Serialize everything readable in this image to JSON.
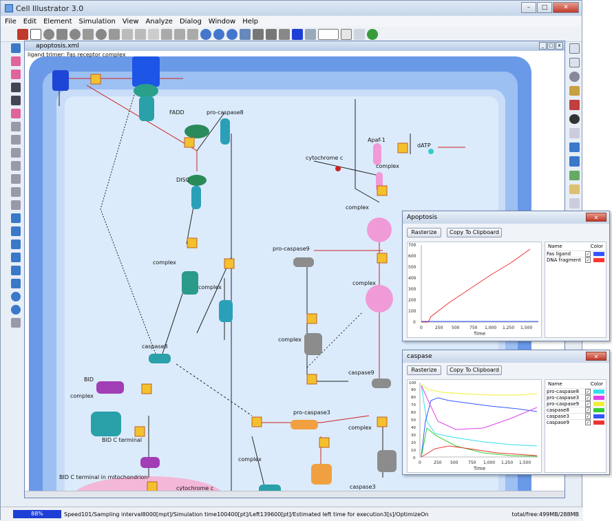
{
  "app": {
    "title": "Cell Illustrator 3.0"
  },
  "menu": [
    "File",
    "Edit",
    "Element",
    "Simulation",
    "View",
    "Analyze",
    "Dialog",
    "Window",
    "Help"
  ],
  "document": {
    "title": "apoptosis.xml"
  },
  "diagram": {
    "labels": {
      "ligand": "ligand trimer: Fas receptor complex",
      "fadd": "FADD",
      "procasp8": "pro-caspase8",
      "disc": "DISC",
      "apaf": "Apaf-1",
      "datp": "dATP",
      "cytc": "cytochrome c",
      "complex": "complex",
      "procasp9": "pro-caspase9",
      "casp8": "caspase8",
      "casp9": "caspase9",
      "procasp3": "pro-caspase3",
      "casp3": "caspase3",
      "bid": "BID",
      "bidc": "BID C terminal",
      "bidmito": "BID C terminal in mitochondrion",
      "cytc2": "cytochrome c"
    }
  },
  "status": {
    "progress": "88%",
    "text": "Speed101/Sampling interval8000[mpt]/Simulation time100400[pt]/Left139600[pt]/Estimated left time for execution3[s]/OptimizeOn",
    "memory": "total/free:499MB/288MB"
  },
  "panels": {
    "apoptosis": {
      "title": "Apoptosis",
      "rasterize": "Rasterize",
      "copy": "Copy To Clipboard",
      "legend_name": "Name",
      "legend_color": "Color",
      "xlabel": "Time",
      "yticks": [
        "700",
        "600",
        "500",
        "400",
        "300",
        "200",
        "100",
        "0"
      ],
      "xticks": [
        "0",
        "250",
        "500",
        "750",
        "1,000",
        "1,250",
        "1,500"
      ],
      "series": [
        {
          "name": "Fas ligand",
          "color": "#3355ff"
        },
        {
          "name": "DNA fragment",
          "color": "#ff3333"
        }
      ]
    },
    "caspase": {
      "title": "caspase",
      "rasterize": "Rasterize",
      "copy": "Copy To Clipboard",
      "legend_name": "Name",
      "legend_color": "Color",
      "xlabel": "Time",
      "yticks": [
        "100",
        "90",
        "80",
        "70",
        "60",
        "50",
        "40",
        "30",
        "20",
        "10",
        "0"
      ],
      "xticks": [
        "0",
        "250",
        "500",
        "750",
        "1,000",
        "1,250",
        "1,500"
      ],
      "series": [
        {
          "name": "pro-caspase8",
          "color": "#33e0ee"
        },
        {
          "name": "pro-caspase3",
          "color": "#e040e8"
        },
        {
          "name": "pro-caspase9",
          "color": "#eeee33"
        },
        {
          "name": "caspase8",
          "color": "#33cc33"
        },
        {
          "name": "caspase3",
          "color": "#3355ff"
        },
        {
          "name": "caspase9",
          "color": "#ee3333"
        }
      ]
    }
  }
}
